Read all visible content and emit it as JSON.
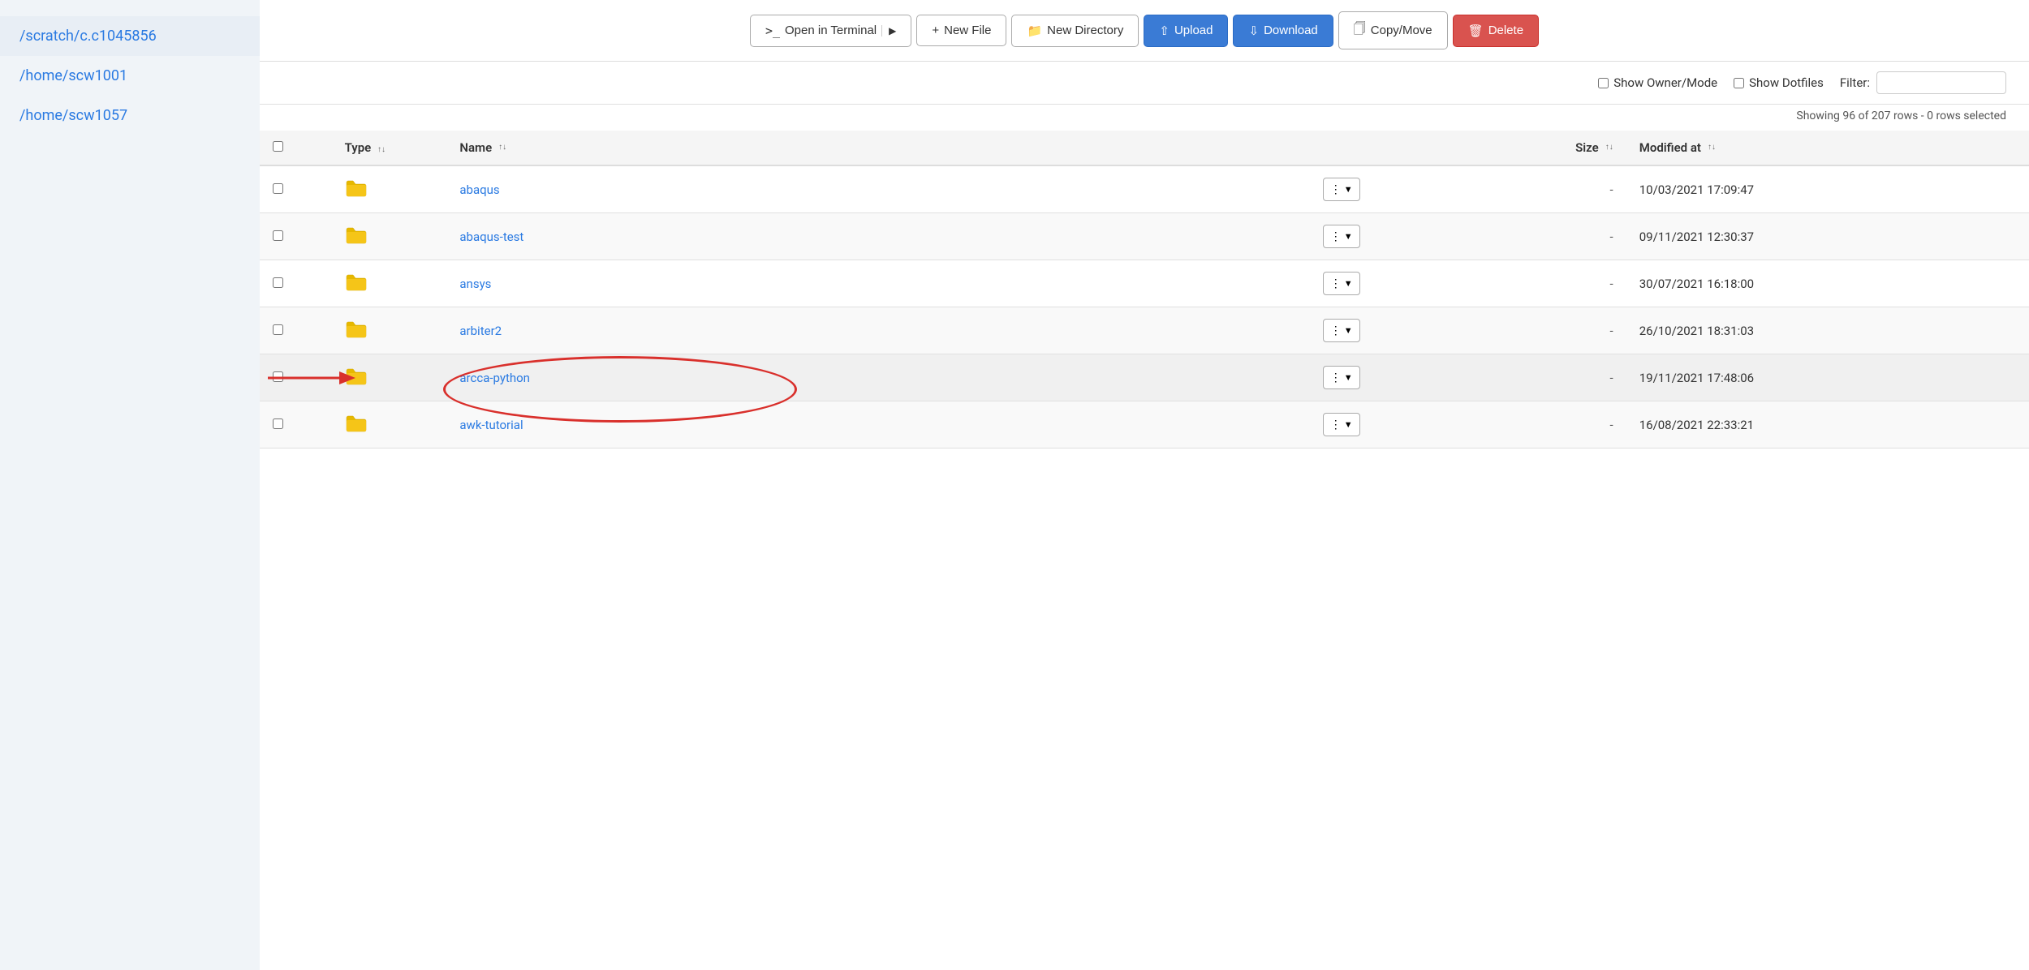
{
  "sidebar": {
    "items": [
      {
        "id": "scratch",
        "label": "/scratch/c.c1045856",
        "active": false
      },
      {
        "id": "home-scw1001",
        "label": "/home/scw1001",
        "active": false
      },
      {
        "id": "home-scw1057",
        "label": "/home/scw1057",
        "active": true
      }
    ]
  },
  "toolbar": {
    "open_terminal_label": "Open in Terminal",
    "new_file_label": "New File",
    "new_directory_label": "New Directory",
    "upload_label": "Upload",
    "download_label": "Download",
    "copy_move_label": "Copy/Move",
    "delete_label": "Delete"
  },
  "options": {
    "show_owner_mode_label": "Show Owner/Mode",
    "show_dotfiles_label": "Show Dotfiles",
    "filter_label": "Filter:",
    "filter_placeholder": ""
  },
  "row_info": {
    "text": "Showing 96 of 207 rows - 0 rows selected"
  },
  "table": {
    "headers": {
      "type": "Type",
      "name": "Name",
      "size": "Size",
      "modified_at": "Modified at"
    },
    "rows": [
      {
        "id": "abaqus",
        "name": "abaqus",
        "type": "folder",
        "size": "-",
        "modified": "10/03/2021 17:09:47",
        "highlighted": false,
        "annotated": false
      },
      {
        "id": "abaqus-test",
        "name": "abaqus-test",
        "type": "folder",
        "size": "-",
        "modified": "09/11/2021 12:30:37",
        "highlighted": false,
        "annotated": false
      },
      {
        "id": "ansys",
        "name": "ansys",
        "type": "folder",
        "size": "-",
        "modified": "30/07/2021 16:18:00",
        "highlighted": false,
        "annotated": false
      },
      {
        "id": "arbiter2",
        "name": "arbiter2",
        "type": "folder",
        "size": "-",
        "modified": "26/10/2021 18:31:03",
        "highlighted": false,
        "annotated": false
      },
      {
        "id": "arcca-python",
        "name": "arcca-python",
        "type": "folder",
        "size": "-",
        "modified": "19/11/2021 17:48:06",
        "highlighted": true,
        "annotated": true
      },
      {
        "id": "awk-tutorial",
        "name": "awk-tutorial",
        "type": "folder",
        "size": "-",
        "modified": "16/08/2021 22:33:21",
        "highlighted": false,
        "annotated": false
      }
    ]
  }
}
